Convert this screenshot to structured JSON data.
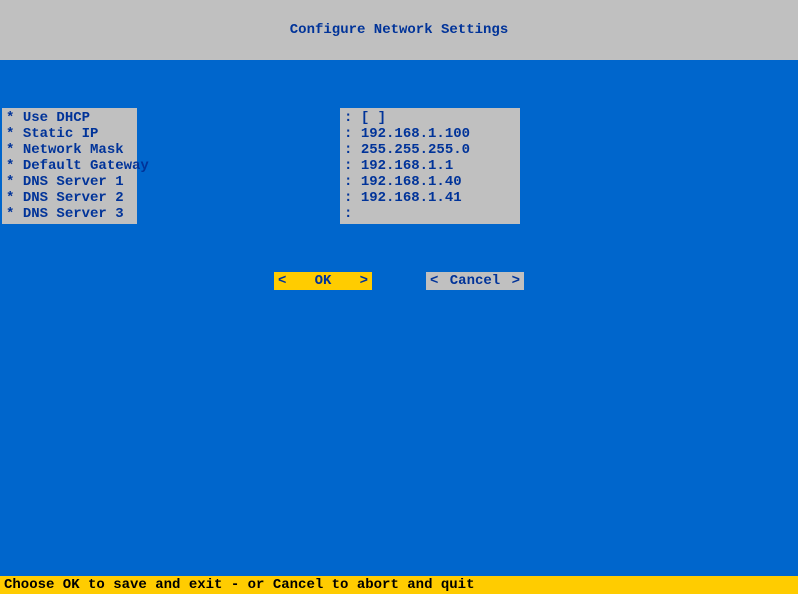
{
  "header": {
    "title": "Configure Network Settings"
  },
  "fields": {
    "items": [
      {
        "label": "Use DHCP",
        "value": "[ ]"
      },
      {
        "label": "Static IP",
        "value": "192.168.1.100"
      },
      {
        "label": "Network Mask",
        "value": "255.255.255.0"
      },
      {
        "label": "Default Gateway",
        "value": "192.168.1.1"
      },
      {
        "label": "DNS Server 1",
        "value": "192.168.1.40"
      },
      {
        "label": "DNS Server 2",
        "value": "192.168.1.41"
      },
      {
        "label": "DNS Server 3",
        "value": ""
      }
    ]
  },
  "buttons": {
    "ok": "OK",
    "cancel": "Cancel",
    "bracket_left": "<",
    "bracket_right": ">"
  },
  "footer": {
    "hint": "Choose OK to save and exit - or Cancel to abort and quit"
  },
  "field_prefix": "* ",
  "value_prefix": ": "
}
